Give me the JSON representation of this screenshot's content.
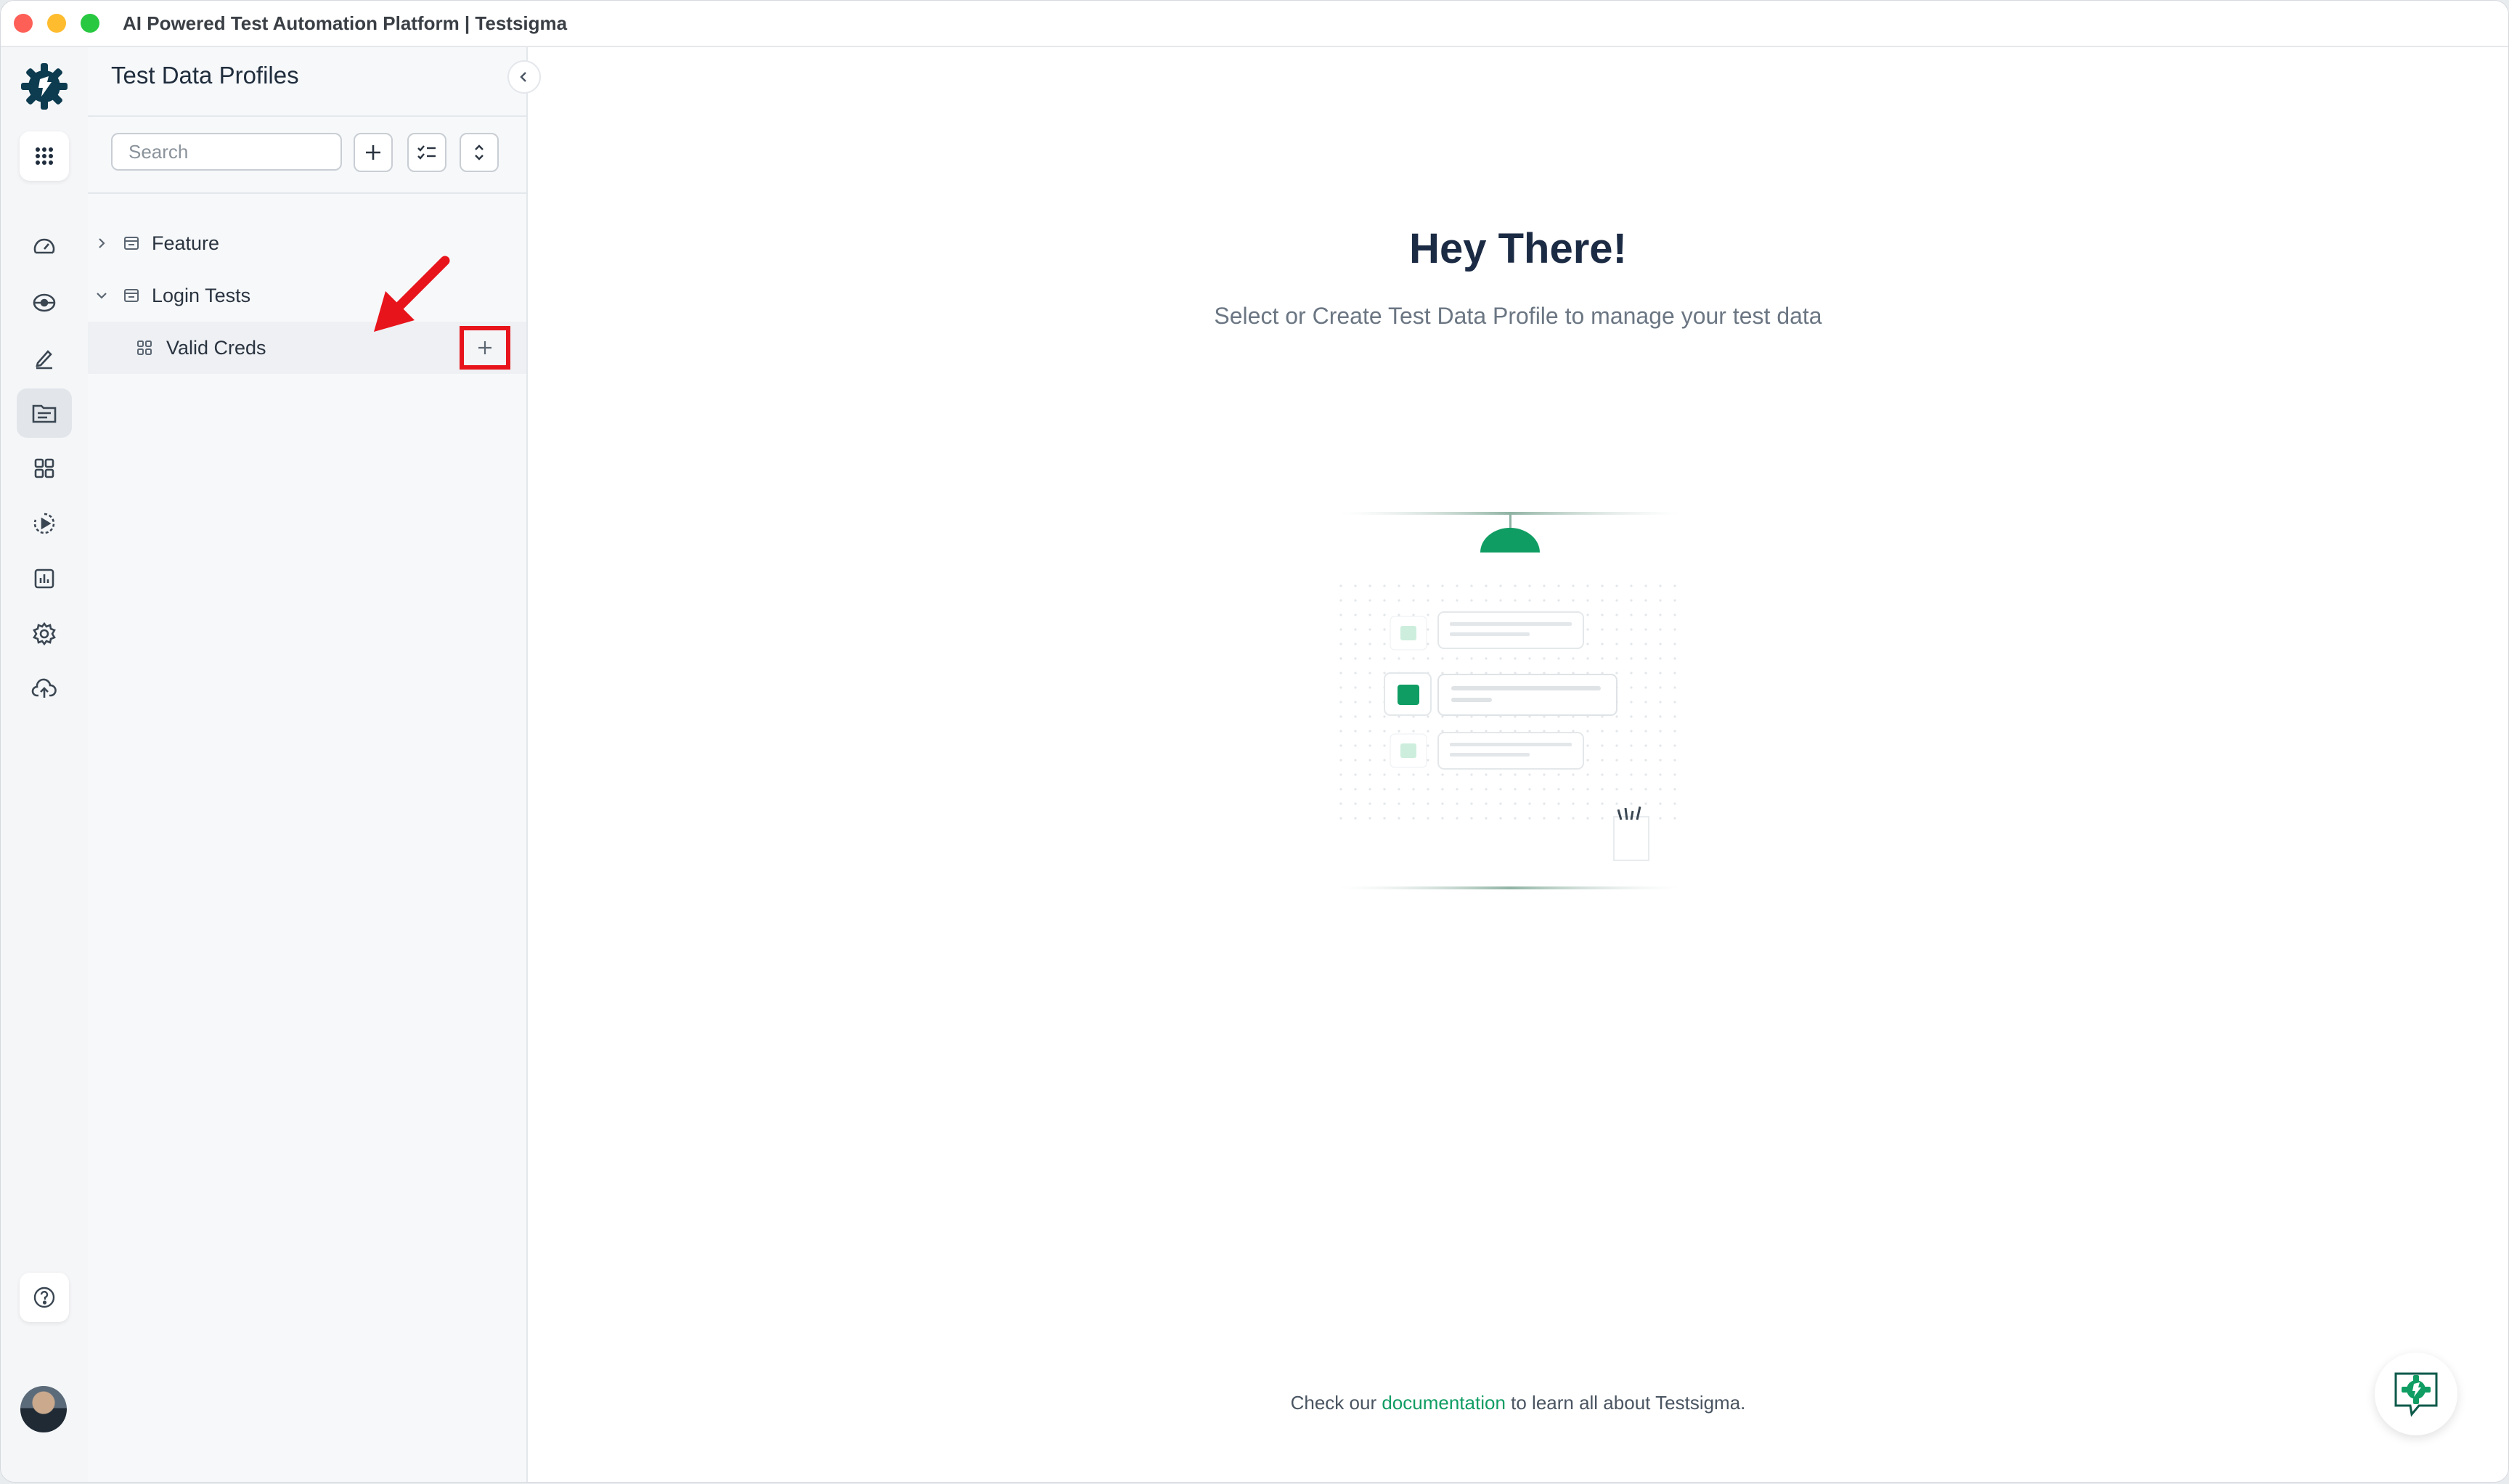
{
  "window": {
    "title": "AI Powered Test Automation Platform | Testsigma"
  },
  "rail": {
    "items": [
      {
        "name": "dashboard-icon"
      },
      {
        "name": "test-plans-icon"
      },
      {
        "name": "test-cases-icon"
      },
      {
        "name": "test-data-icon",
        "active": true
      },
      {
        "name": "elements-icon"
      },
      {
        "name": "runs-icon"
      },
      {
        "name": "reports-icon"
      },
      {
        "name": "settings-icon"
      },
      {
        "name": "uploads-icon"
      }
    ]
  },
  "panel": {
    "title": "Test Data Profiles",
    "search_placeholder": "Search",
    "tree": [
      {
        "label": "Feature",
        "expanded": false
      },
      {
        "label": "Login Tests",
        "expanded": true,
        "children": [
          {
            "label": "Valid Creds"
          }
        ]
      }
    ]
  },
  "main": {
    "title": "Hey There!",
    "subtitle": "Select or Create Test Data Profile to manage your test data",
    "footer_prefix": "Check our ",
    "footer_link": "documentation",
    "footer_suffix": " to learn all about Testsigma."
  },
  "colors": {
    "brand": "#0f9d63",
    "brand_dark": "#0d3b4f",
    "highlight": "#e8141b"
  }
}
